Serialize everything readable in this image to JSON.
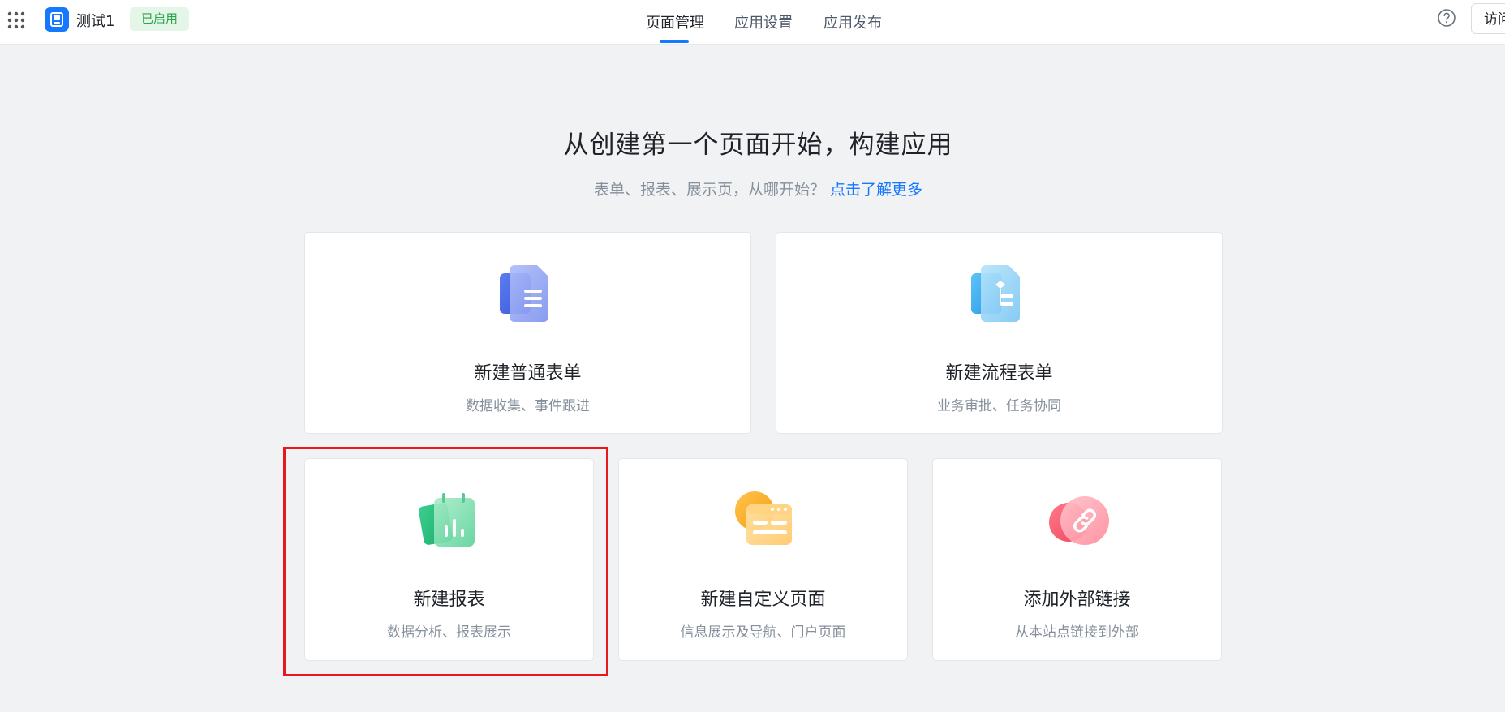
{
  "header": {
    "app_name": "测试1",
    "status": "已启用",
    "tabs": [
      {
        "label": "页面管理",
        "active": true
      },
      {
        "label": "应用设置",
        "active": false
      },
      {
        "label": "应用发布",
        "active": false
      }
    ],
    "visit_label": "访问"
  },
  "hero": {
    "title": "从创建第一个页面开始，构建应用",
    "subtitle": "表单、报表、展示页，从哪开始？",
    "link": "点击了解更多"
  },
  "cards": [
    {
      "title": "新建普通表单",
      "desc": "数据收集、事件跟进",
      "icon": "form-icon"
    },
    {
      "title": "新建流程表单",
      "desc": "业务审批、任务协同",
      "icon": "workflow-icon"
    },
    {
      "title": "新建报表",
      "desc": "数据分析、报表展示",
      "icon": "report-icon"
    },
    {
      "title": "新建自定义页面",
      "desc": "信息展示及导航、门户页面",
      "icon": "custom-page-icon"
    },
    {
      "title": "添加外部链接",
      "desc": "从本站点链接到外部",
      "icon": "link-icon"
    }
  ],
  "colors": {
    "accent": "#1677ff",
    "badge_bg": "#e3f6e8",
    "badge_text": "#2ba44b",
    "highlight": "#e8191c"
  }
}
